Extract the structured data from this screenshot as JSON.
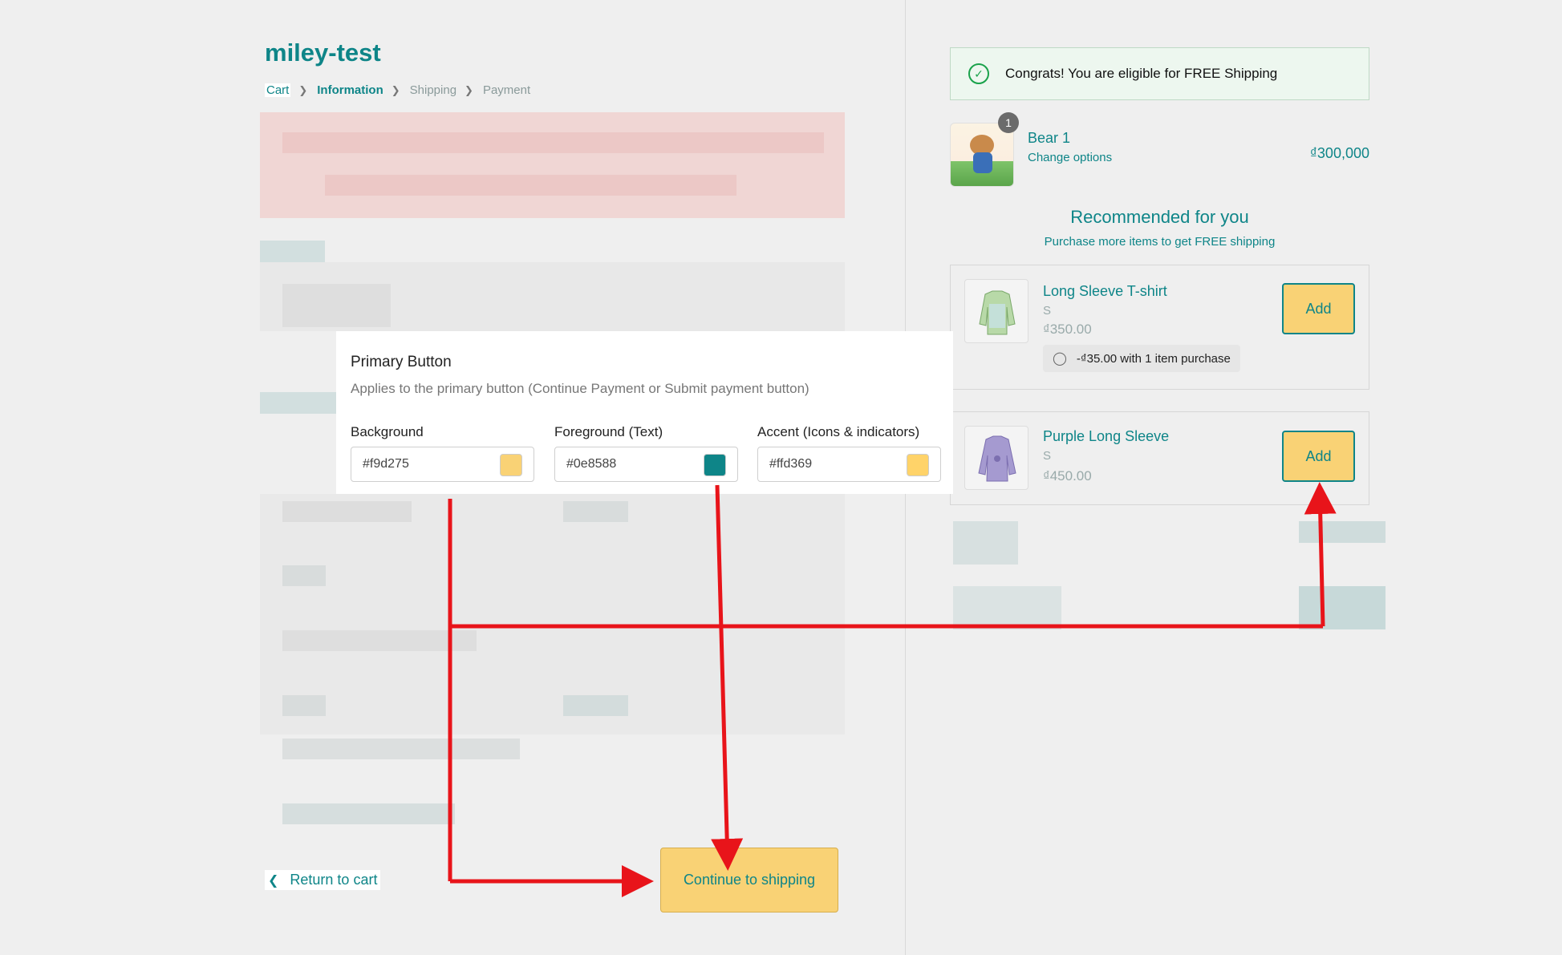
{
  "store": {
    "title": "miley-test"
  },
  "breadcrumb": [
    {
      "label": "Cart"
    },
    {
      "label": "Information"
    },
    {
      "label": "Shipping"
    },
    {
      "label": "Payment"
    }
  ],
  "popup": {
    "title": "Primary Button",
    "subtitle": "Applies to the primary button (Continue Payment or Submit payment button)",
    "fields": [
      {
        "label": "Background",
        "value": "#f9d275",
        "color": "#f9d275"
      },
      {
        "label": "Foreground (Text)",
        "value": "#0e8588",
        "color": "#0e8588"
      },
      {
        "label": "Accent (Icons & indicators)",
        "value": "#ffd369",
        "color": "#ffd369"
      }
    ]
  },
  "footer": {
    "return_label": "Return to cart",
    "continue_label": "Continue to shipping"
  },
  "summary": {
    "free_shipping": "Congrats! You are eligible for FREE Shipping",
    "cart_item": {
      "name": "Bear 1",
      "options_link": "Change options",
      "price": "₫300,000",
      "quantity": "1"
    },
    "recommended": {
      "title": "Recommended for you",
      "subtitle": "Purchase more items to get FREE shipping",
      "items": [
        {
          "name": "Long Sleeve T-shirt",
          "variant": "S",
          "price": "₫350.00",
          "discount": "-₫35.00 with 1 item purchase",
          "add_label": "Add"
        },
        {
          "name": "Purple Long Sleeve",
          "variant": "S",
          "price": "₫450.00",
          "add_label": "Add"
        }
      ]
    }
  },
  "colors": {
    "primary_background": "#f9d275",
    "primary_foreground": "#0e8588",
    "accent": "#ffd369",
    "annotation_arrow": "#e8141a"
  }
}
